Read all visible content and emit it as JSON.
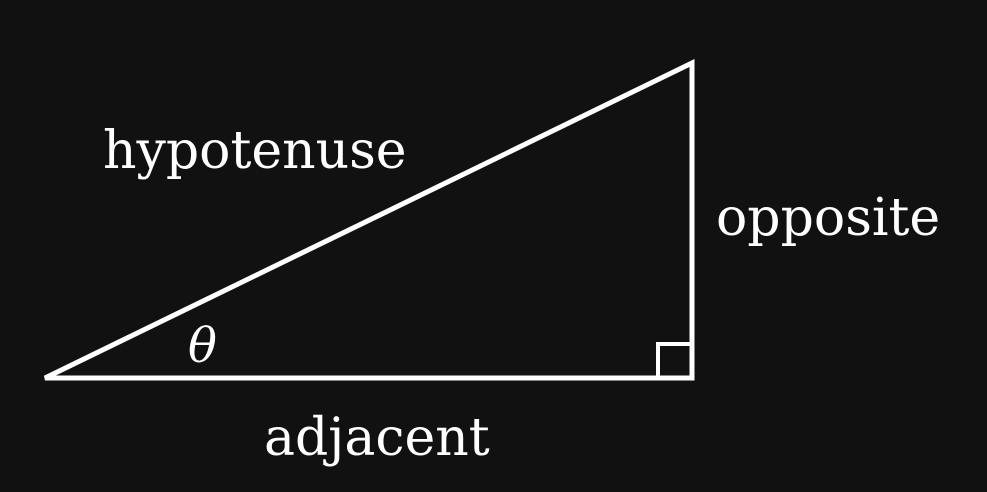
{
  "diagram": {
    "type": "right-triangle",
    "labels": {
      "hypotenuse": "hypotenuse",
      "opposite": "opposite",
      "adjacent": "adjacent",
      "angle": "θ"
    },
    "colors": {
      "background": "#111111",
      "stroke": "#ffffff",
      "text": "#ffffff"
    }
  }
}
